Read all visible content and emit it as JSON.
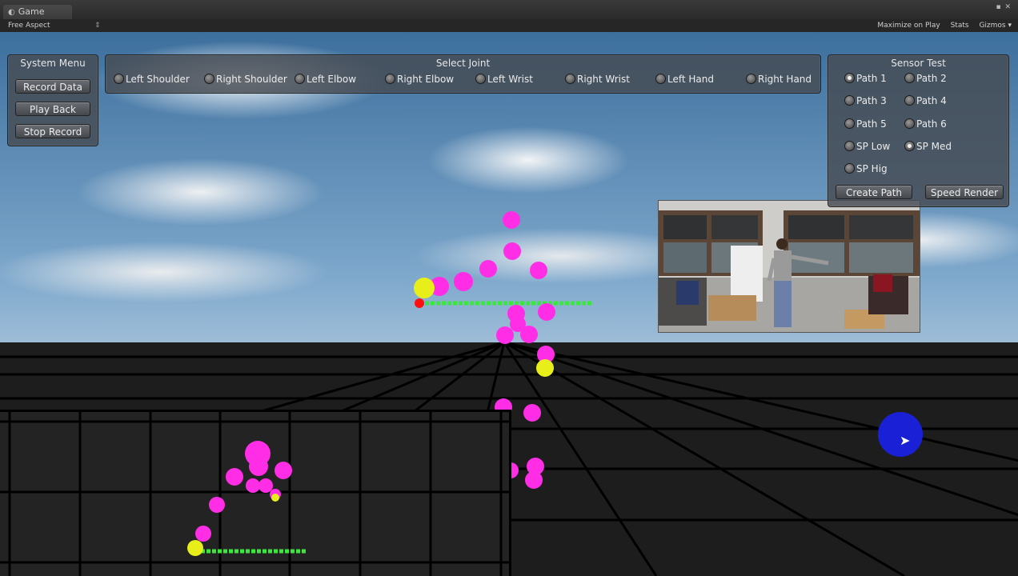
{
  "window": {
    "tab_label": "Game",
    "controls": "▪ ✕"
  },
  "toolbar": {
    "aspect": "Free Aspect",
    "aspect_arrow": "⇕",
    "maximize": "Maximize on Play",
    "stats": "Stats",
    "gizmos": "Gizmos ▾"
  },
  "system_menu": {
    "title": "System Menu",
    "buttons": [
      "Record Data",
      "Play Back",
      "Stop Record"
    ]
  },
  "select_joint": {
    "title": "Select Joint",
    "joints": [
      "Left Shoulder",
      "Right Shoulder",
      "Left Elbow",
      "Right Elbow",
      "Left Wrist",
      "Right Wrist",
      "Left Hand",
      "Right Hand"
    ]
  },
  "sensor_test": {
    "title": "Sensor Test",
    "options": [
      {
        "label": "Path 1",
        "selected": true
      },
      {
        "label": "Path 2",
        "selected": false
      },
      {
        "label": "Path 3",
        "selected": false
      },
      {
        "label": "Path 4",
        "selected": false
      },
      {
        "label": "Path 5",
        "selected": false
      },
      {
        "label": "Path 6",
        "selected": false
      },
      {
        "label": "SP Low",
        "selected": false
      },
      {
        "label": "SP Med",
        "selected": true
      },
      {
        "label": "SP Hig",
        "selected": false
      }
    ],
    "buttons": [
      "Create Path",
      "Speed Render"
    ]
  },
  "colors": {
    "joint": "#ff2ee6",
    "highlight": "#e8ee1a",
    "path": "#39e83a",
    "origin": "#ff1010",
    "cursor": "#1a20d6"
  },
  "icons": {
    "unity_tab": "unity-icon",
    "cursor": "pointer-arrow-icon"
  }
}
